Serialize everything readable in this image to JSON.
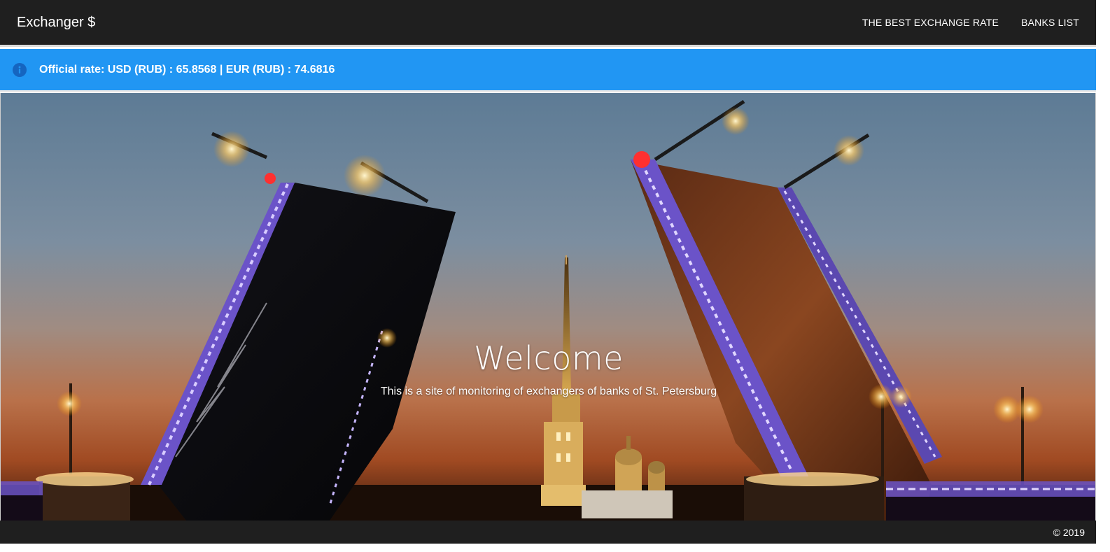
{
  "navbar": {
    "brand": "Exchanger $",
    "links": [
      {
        "label": "THE BEST EXCHANGE RATE"
      },
      {
        "label": "BANKS LIST"
      }
    ]
  },
  "info_bar": {
    "icon": "info-icon",
    "text": "Official rate: USD (RUB) : 65.8568 | EUR (RUB) : 74.6816"
  },
  "hero": {
    "title": "Welcome",
    "subtitle": "This is a site of monitoring of exchangers of banks of St. Petersburg",
    "image": "raised-drawbridge-night-photo"
  },
  "footer": {
    "copyright": "© 2019"
  },
  "colors": {
    "navbar_bg": "#1f1f1f",
    "info_bg": "#2196f3",
    "info_icon_bg": "#1565c0",
    "footer_bg": "#1f1f1f"
  }
}
